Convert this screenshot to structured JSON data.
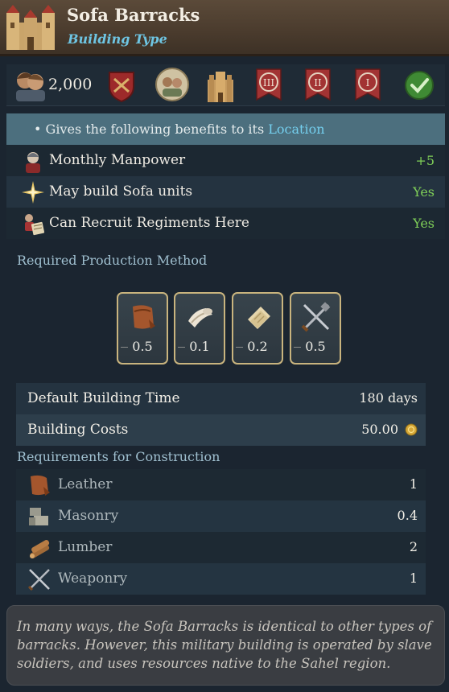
{
  "header": {
    "title": "Sofa Barracks",
    "subtitle": "Building Type",
    "icon": "castle-icon"
  },
  "icon_bar": {
    "manpower_value": "2,000",
    "icons": [
      "manpower-portrait-icon",
      "red-shield-icon",
      "characters-icon",
      "building-icon",
      "rank-iii-banner-icon",
      "rank-ii-banner-icon",
      "rank-i-banner-icon",
      "green-check-icon"
    ],
    "banners": [
      "III",
      "II",
      "I"
    ]
  },
  "benefits": {
    "bullet": "•",
    "prefix": "Gives the following benefits to its",
    "location": "Location",
    "rows": [
      {
        "label": "Monthly Manpower",
        "value": "+5",
        "icon": "soldier-icon"
      },
      {
        "label": "May build Sofa units",
        "value": "Yes",
        "icon": "star-icon"
      },
      {
        "label": "Can Recruit Regiments Here",
        "value": "Yes",
        "icon": "recruit-icon"
      }
    ]
  },
  "production": {
    "heading": "Required Production Method",
    "items": [
      {
        "icon": "leather-icon",
        "value": "0.5"
      },
      {
        "icon": "cloth-icon",
        "value": "0.1"
      },
      {
        "icon": "paper-icon",
        "value": "0.2"
      },
      {
        "icon": "weaponry-icon",
        "value": "0.5"
      }
    ]
  },
  "build": {
    "time_label": "Default Building Time",
    "time_value": "180 days",
    "cost_label": "Building Costs",
    "cost_value": "50.00",
    "cost_icon": "gold-coin-icon"
  },
  "requirements": {
    "heading": "Requirements for Construction",
    "rows": [
      {
        "label": "Leather",
        "value": "1",
        "icon": "leather-icon"
      },
      {
        "label": "Masonry",
        "value": "0.4",
        "icon": "masonry-icon"
      },
      {
        "label": "Lumber",
        "value": "2",
        "icon": "lumber-icon"
      },
      {
        "label": "Weaponry",
        "value": "1",
        "icon": "weaponry-icon"
      }
    ]
  },
  "description": "In many ways, the Sofa Barracks is identical to other types of barracks. However, this military building is operated by slave soldiers, and uses resources native to the Sahel region.",
  "colors": {
    "accent_blue": "#6ec5e3",
    "positive_green": "#7fcf58",
    "header_brown": "#4a3b2d",
    "frame_gold": "#c9b47e"
  }
}
